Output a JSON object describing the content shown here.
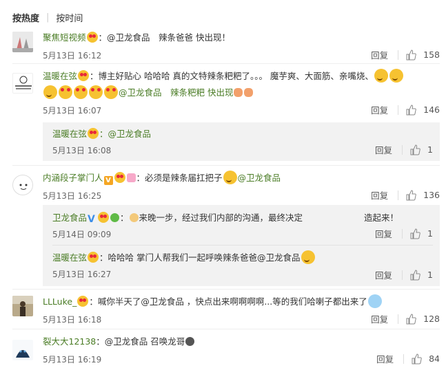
{
  "sort": {
    "hot": "按热度",
    "time": "按时间"
  },
  "labels": {
    "reply": "回复"
  },
  "comments": [
    {
      "user": "聚焦短视频",
      "text": "：@卫龙食品　辣条爸爸 快出现！",
      "time": "5月13日  16:12",
      "likes": "158"
    },
    {
      "user": "温暖在弦",
      "text": "：博主好贴心 哈哈哈 真的文特辣条粑粑了。。。 魔芋爽、大面筋、亲嘴烧、",
      "text2": "@卫龙食品　辣条粑粑 快出现",
      "time": "5月13日  16:07",
      "likes": "146",
      "reply": {
        "user": "温暖在弦",
        "text": "：@卫龙食品",
        "time": "5月13日  16:08",
        "likes": "1"
      }
    },
    {
      "user": "内涵段子掌门人",
      "text": "：必须是辣条届扛把子",
      "text2": "@卫龙食品",
      "time": "5月13日  16:25",
      "likes": "136",
      "replies": [
        {
          "user": "卫龙食品",
          "text": "来晚一步，经过我们内部的沟通，最终决定",
          "text_tail": "造起来！",
          "time": "5月14日  09:09",
          "likes": "1"
        },
        {
          "user": "温暖在弦",
          "text": "：哈哈哈 掌门人帮我们一起呼唤辣条爸爸@卫龙食品",
          "time": "5月13日  16:27",
          "likes": "1"
        }
      ]
    },
    {
      "user": "LLLuke_",
      "text": "：喊你半天了@卫龙食品 ，快点出来啊啊啊啊...等的我们哈喇子都出来了",
      "time": "5月13日  16:18",
      "likes": "128"
    },
    {
      "user": "裂大大12138",
      "text": "：@卫龙食品 召唤龙哥",
      "time": "5月13日  16:19",
      "likes": "84"
    }
  ]
}
